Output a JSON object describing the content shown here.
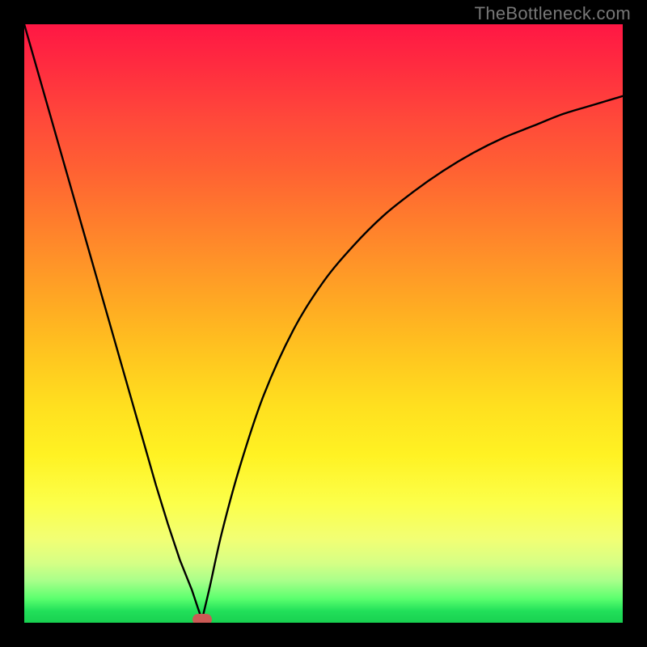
{
  "watermark": "TheBottleneck.com",
  "colors": {
    "page_bg": "#000000",
    "curve": "#000000",
    "marker": "#cb5a55"
  },
  "chart_data": {
    "type": "line",
    "title": "",
    "xlabel": "",
    "ylabel": "",
    "xlim": [
      0,
      100
    ],
    "ylim": [
      0,
      100
    ],
    "grid": false,
    "legend": false,
    "annotations": [],
    "series": [
      {
        "name": "left-branch",
        "x": [
          0,
          2,
          4,
          6,
          8,
          10,
          12,
          14,
          16,
          18,
          20,
          22,
          24,
          26,
          28,
          29,
          29.7
        ],
        "y": [
          100,
          93,
          86,
          79,
          72,
          65,
          58,
          51,
          44,
          37,
          30,
          23,
          16.5,
          10.5,
          5.5,
          2.5,
          0.5
        ]
      },
      {
        "name": "right-branch",
        "x": [
          29.7,
          31,
          33,
          36,
          40,
          45,
          50,
          55,
          60,
          65,
          70,
          75,
          80,
          85,
          90,
          95,
          100
        ],
        "y": [
          0.5,
          6,
          15,
          26,
          38,
          49,
          57,
          63,
          68,
          72,
          75.5,
          78.5,
          81,
          83,
          85,
          86.5,
          88
        ]
      }
    ],
    "marker": {
      "x": 29.7,
      "y": 0.6
    }
  }
}
